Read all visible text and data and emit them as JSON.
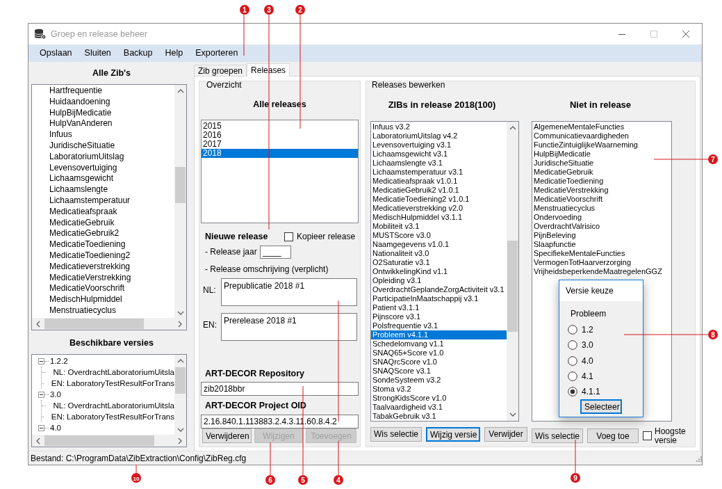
{
  "window": {
    "title": "Groep en release beheer"
  },
  "menu": [
    "Opslaan",
    "Sluiten",
    "Backup",
    "Help",
    "Exporteren"
  ],
  "left": {
    "zibs_title": "Alle Zib's",
    "zibs": [
      "Hartfrequentie",
      "Huidaandoening",
      "HulpBijMedicatie",
      "HulpVanAnderen",
      "Infuus",
      "JuridischeSituatie",
      "LaboratoriumUitslag",
      "Levensovertuiging",
      "Lichaamsgewicht",
      "Lichaamslengte",
      "Lichaamstemperatuur",
      "Medicatieafspraak",
      "MedicatieGebruik",
      "MedicatieGebruik2",
      "MedicatieToediening",
      "MedicatieToediening2",
      "Medicatieverstrekking",
      "MedicatieVerstrekking",
      "MedicatieVoorschrift",
      "MedischHulpmiddel",
      "Menstruatiecyclus"
    ],
    "versions_title": "Beschikbare versies",
    "versions_tree": [
      {
        "label": "1.2.2",
        "expanded": true,
        "children": [
          {
            "label": "NL: OverdrachtLaboratoriumUitsla"
          },
          {
            "label": "EN: LaboratoryTestResultForTrans"
          }
        ]
      },
      {
        "label": "3.0",
        "expanded": true,
        "children": [
          {
            "label": "NL: OverdrachtLaboratoriumUitsla"
          },
          {
            "label": "EN: LaboratoryTestResultForTrans"
          }
        ]
      },
      {
        "label": "4.0",
        "expanded": true
      }
    ]
  },
  "tabs": [
    {
      "label": "Zib groepen",
      "selected": false
    },
    {
      "label": "Releases",
      "selected": true
    }
  ],
  "overview": {
    "legend": "Overzicht",
    "title": "Alle releases",
    "releases": [
      {
        "label": "2015",
        "selected": false
      },
      {
        "label": "2016",
        "selected": false
      },
      {
        "label": "2017",
        "selected": false
      },
      {
        "label": "2018",
        "selected": true
      }
    ],
    "new_release_title": "Nieuwe release",
    "copy_release": {
      "label": "Kopieer release",
      "checked": false
    },
    "year_label": "- Release jaar",
    "year_value": "____",
    "description_label": "- Release omschrijving (verplicht)",
    "nl_label": "NL:",
    "nl_value": "Prepublicatie 2018 #1",
    "en_label": "EN:",
    "en_value": "Prerelease 2018 #1",
    "repo_title": "ART-DECOR Repository",
    "repo_value": "zib2018bbr",
    "oid_title": "ART-DECOR Project OID",
    "oid_value": "2.16.840.1.113883.2.4.3.11.60.8.4.2",
    "buttons": [
      {
        "label": "Verwijderen",
        "disabled": false
      },
      {
        "label": "Wijzigen",
        "disabled": true
      },
      {
        "label": "Toevoegen",
        "disabled": true
      }
    ]
  },
  "edit": {
    "legend": "Releases bewerken",
    "in_title": "ZIBs in release 2018(100)",
    "in_items": [
      {
        "label": "Infuus v3.2",
        "selected": false
      },
      {
        "label": "LaboratoriumUitslag v4.2",
        "selected": false
      },
      {
        "label": "Levensovertuiging v3.1",
        "selected": false
      },
      {
        "label": "Lichaamsgewicht v3.1",
        "selected": false
      },
      {
        "label": "Lichaamslengte v3.1",
        "selected": false
      },
      {
        "label": "Lichaamstemperatuur v3.1",
        "selected": false
      },
      {
        "label": "Medicatieafspraak v1.0.1",
        "selected": false
      },
      {
        "label": "MedicatieGebruik2 v1.0.1",
        "selected": false
      },
      {
        "label": "MedicatieToediening2 v1.0.1",
        "selected": false
      },
      {
        "label": "Medicatieverstrekking v2.0",
        "selected": false
      },
      {
        "label": "MedischHulpmiddel v3.1.1",
        "selected": false
      },
      {
        "label": "Mobiliteit v3.1",
        "selected": false
      },
      {
        "label": "MUSTScore v3.0",
        "selected": false
      },
      {
        "label": "Naamgegevens v1.0.1",
        "selected": false
      },
      {
        "label": "Nationaliteit v3.0",
        "selected": false
      },
      {
        "label": "O2Saturatie v3.1",
        "selected": false
      },
      {
        "label": "OntwikkelingKind v1.1",
        "selected": false
      },
      {
        "label": "Opleiding v3.1",
        "selected": false
      },
      {
        "label": "OverdrachtGeplandeZorgActiviteit v3.1",
        "selected": false
      },
      {
        "label": "ParticipatieInMaatschappij v3.1",
        "selected": false
      },
      {
        "label": "Patient v3.1.1",
        "selected": false
      },
      {
        "label": "Pijnscore v3.1",
        "selected": false
      },
      {
        "label": "Polsfrequentie v3.1",
        "selected": false
      },
      {
        "label": "Probleem v4.1.1",
        "selected": true
      },
      {
        "label": "Schedelomvang v1.1",
        "selected": false
      },
      {
        "label": "SNAQ65+Score v1.0",
        "selected": false
      },
      {
        "label": "SNAQrcScore v1.0",
        "selected": false
      },
      {
        "label": "SNAQScore v3.1",
        "selected": false
      },
      {
        "label": "SondeSysteem v3.2",
        "selected": false
      },
      {
        "label": "Stoma v3.2",
        "selected": false
      },
      {
        "label": "StrongKidsScore v1.0",
        "selected": false
      },
      {
        "label": "Taalvaardigheid v3.1",
        "selected": false
      },
      {
        "label": "TabakGebruik v3.1",
        "selected": false
      }
    ],
    "out_title": "Niet in release",
    "out_items": [
      "AlgemeneMentaleFuncties",
      "Communicatievaardigheden",
      "FunctieZintuiglijkeWaarneming",
      "HulpBijMedicatie",
      "JuridischeSituatie",
      "MedicatieGebruik",
      "MedicatieToediening",
      "MedicatieVerstrekking",
      "MedicatieVoorschrift",
      "Menstruatiecyclus",
      "Ondervoeding",
      "OverdrachtValrisico",
      "PijnBeleving",
      "Slaapfunctie",
      "SpecifiekeMentaleFuncties",
      "VermogenTotHaarverzorging",
      "VrijheidsbeperkendeMaatregelenGGZ"
    ],
    "in_buttons": [
      {
        "label": "Wis selectie",
        "focused": false
      },
      {
        "label": "Wijzig versie",
        "focused": true
      },
      {
        "label": "Verwijder",
        "focused": false
      }
    ],
    "out_buttons": [
      {
        "label": "Wis selectie"
      },
      {
        "label": "Voeg toe"
      }
    ],
    "highest_version": {
      "label": "Hoogste versie",
      "checked": false
    }
  },
  "dialog": {
    "title": "Versie keuze",
    "zib": "Probleem",
    "options": [
      {
        "label": "1.2",
        "selected": false
      },
      {
        "label": "3.0",
        "selected": false
      },
      {
        "label": "4.0",
        "selected": false
      },
      {
        "label": "4.1",
        "selected": false
      },
      {
        "label": "4.1.1",
        "selected": true
      }
    ],
    "button": "Selecteer"
  },
  "status_bar": "Bestand: C:\\ProgramData\\ZibExtraction\\Config\\ZibReg.cfg",
  "callouts": [
    {
      "number": "1"
    },
    {
      "number": "3"
    },
    {
      "number": "2"
    },
    {
      "number": "7"
    },
    {
      "number": "8"
    },
    {
      "number": "10"
    },
    {
      "number": "6"
    },
    {
      "number": "5"
    },
    {
      "number": "4"
    },
    {
      "number": "9"
    }
  ]
}
